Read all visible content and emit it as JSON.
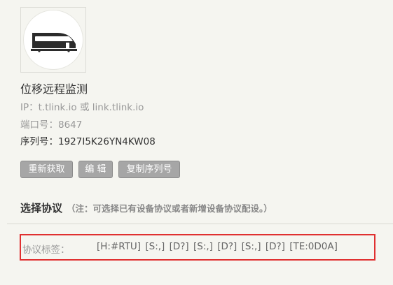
{
  "device": {
    "name": "位移远程监测",
    "ip_line": "IP：t.tlink.io 或 link.tlink.io",
    "port_line": "端口号：8647",
    "serial_line": "序列号：1927I5K26YN4KW08",
    "avatar_icon": "train-icon"
  },
  "actions": {
    "refetch_label": "重新获取",
    "edit_label": "编 辑",
    "copy_serial_label": "复制序列号"
  },
  "protocol": {
    "section_title": "选择协议",
    "note": "（注：可选择已有设备协议或者新增设备协议配设。）",
    "tag_label": "协议标签：",
    "tag_values": "[H:#RTU]  [S:,]  [D?]  [S:,]  [D?]  [S:,]  [D?]  [TE:0D0A]"
  },
  "colors": {
    "background": "#f5f5f0",
    "button_bg": "#a6a6a6",
    "highlight_border": "#e03030"
  }
}
